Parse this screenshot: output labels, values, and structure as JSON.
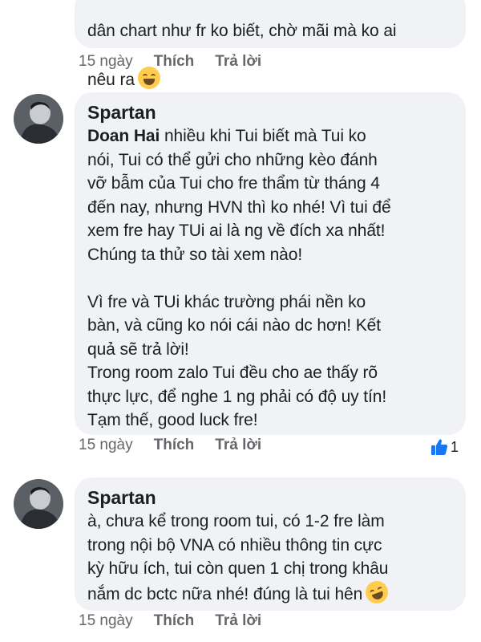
{
  "colors": {
    "bubble": "#f0f2f5",
    "meta_text": "#65676b",
    "like_blue": "#1877f2",
    "emoji_yellow": "#ffcc4d"
  },
  "comments": [
    {
      "author": "",
      "text_lines": [
        "dân chart như fr ko biết, chờ mãi mà ko ai",
        "nêu ra"
      ],
      "emoji": "laughing-emoji",
      "time": "15 ngày",
      "like_label": "Thích",
      "reply_label": "Trả lời"
    },
    {
      "author": "Spartan",
      "mention": "Doan Hai",
      "text_after_mention": "  nhiều khi Tui biết mà Tui ko\nnói, Tui có thể gửi cho những kèo đánh\nvỡ bẫm của Tui cho fre thẩm từ tháng 4\nđến nay, nhưng HVN thì ko nhé! Vì tui để\nxem fre hay TUi ai là ng về đích xa nhất!\nChúng ta thử so tài xem nào!\n\nVì fre và TUi khác trường phái nền ko\nbàn, và cũng ko nói cái nào dc hơn! Kết\nquả sẽ trả lời!\nTrong room zalo Tui đều cho ae thấy rõ\nthực lực, để nghe 1 ng phải có độ uy tín!\nTạm thế, good luck fre!",
      "time": "15 ngày",
      "like_label": "Thích",
      "reply_label": "Trả lời",
      "like_count": "1"
    },
    {
      "author": "Spartan",
      "text": "à, chưa kể trong room tui, có 1-2 fre làm\ntrong nội bộ VNA có nhiều thông tin cực\nkỳ hữu ích, tui còn quen 1 chị trong khâu\nnắm dc bctc nữa nhé! đúng là tui hên",
      "emoji": "rofl-emoji",
      "time": "15 ngày",
      "like_label": "Thích",
      "reply_label": "Trả lời"
    }
  ]
}
